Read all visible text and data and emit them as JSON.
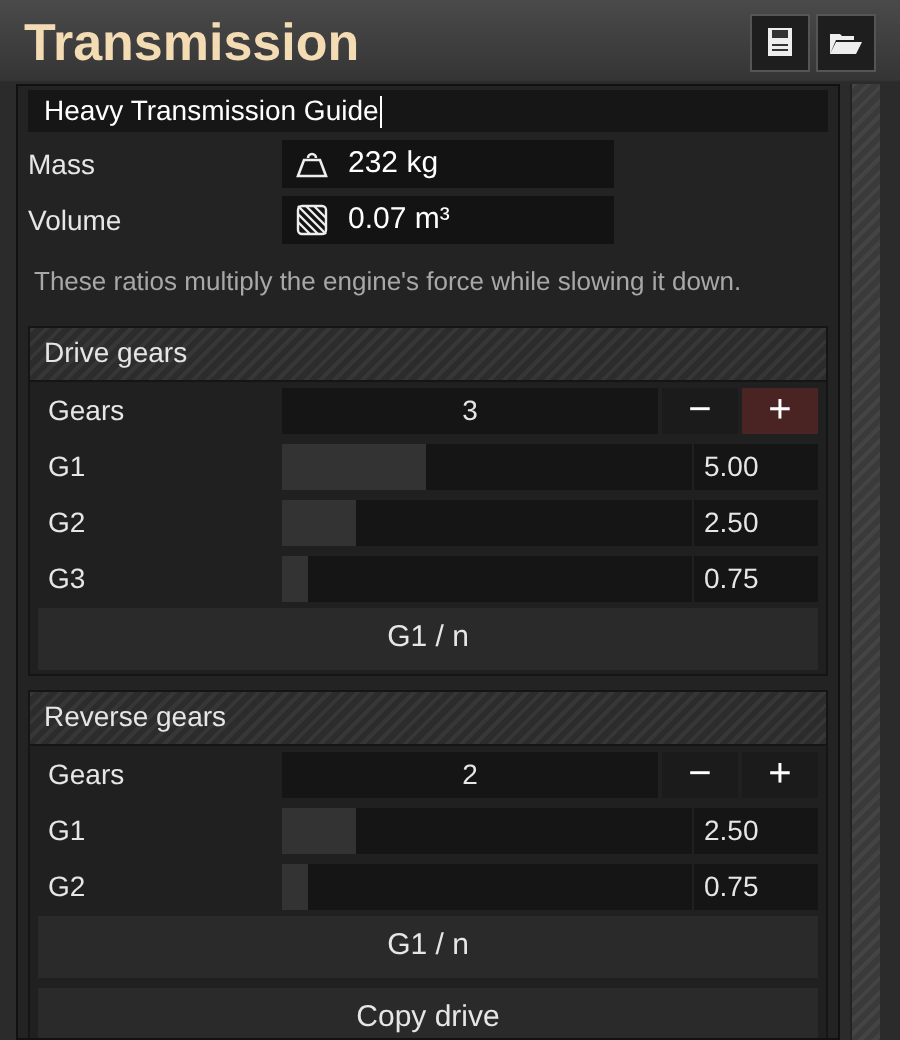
{
  "window": {
    "title": "Transmission"
  },
  "name_field": {
    "value": "Heavy Transmission Guide"
  },
  "properties": [
    {
      "label": "Mass",
      "kind": "weight",
      "value": "232 kg"
    },
    {
      "label": "Volume",
      "kind": "volume",
      "value": "0.07 m³"
    }
  ],
  "description": "These ratios multiply the engine's force while slowing it down.",
  "sections": [
    {
      "title": "Drive gears",
      "count_label": "Gears",
      "count": "3",
      "minus": {
        "label": "−",
        "highlighted": false
      },
      "plus": {
        "label": "+",
        "highlighted": true
      },
      "gears": [
        {
          "label": "G1",
          "level": 0.35,
          "value": "5.00"
        },
        {
          "label": "G2",
          "level": 0.18,
          "value": "2.50"
        },
        {
          "label": "G3",
          "level": 0.065,
          "value": "0.75"
        }
      ],
      "buttons": [
        "G1 / n"
      ]
    },
    {
      "title": "Reverse gears",
      "count_label": "Gears",
      "count": "2",
      "minus": {
        "label": "−",
        "highlighted": false
      },
      "plus": {
        "label": "+",
        "highlighted": false
      },
      "gears": [
        {
          "label": "G1",
          "level": 0.18,
          "value": "2.50"
        },
        {
          "label": "G2",
          "level": 0.065,
          "value": "0.75"
        }
      ],
      "buttons": [
        "G1 / n",
        "Copy drive"
      ]
    }
  ]
}
